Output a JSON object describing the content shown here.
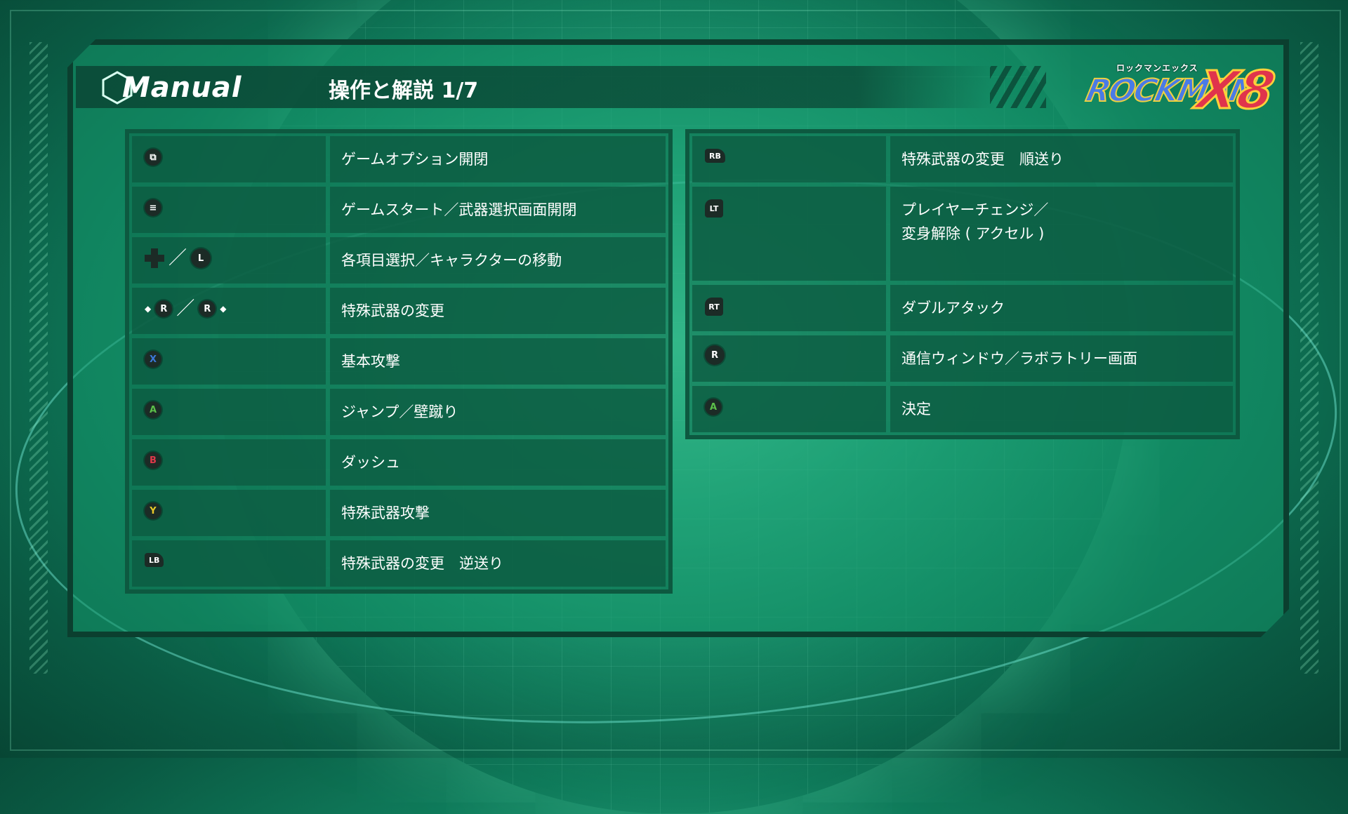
{
  "header": {
    "manual_label": "Manual",
    "page_title": "操作と解説 1/7",
    "game_logo_kana": "ロックマンエックス",
    "game_logo_title": "ROCKMAN",
    "game_logo_number": "X8"
  },
  "left_rows": [
    {
      "icon": "view-button-icon",
      "glyph": "⧉",
      "desc": "ゲームオプション開閉"
    },
    {
      "icon": "menu-button-icon",
      "glyph": "≡",
      "desc": "ゲームスタート／武器選択画面開閉"
    },
    {
      "icon": "dpad-left-stick-icon",
      "glyph": "L",
      "sep": "／",
      "desc": "各項目選択／キャラクターの移動"
    },
    {
      "icon": "right-stick-left-right-icon",
      "glyph_a": "R",
      "glyph_b": "R",
      "sep": "／",
      "desc": "特殊武器の変更"
    },
    {
      "icon": "x-button-icon",
      "glyph": "X",
      "color": "#3c78d8",
      "desc": "基本攻撃"
    },
    {
      "icon": "a-button-icon",
      "glyph": "A",
      "color": "#5cc04a",
      "desc": "ジャンプ／壁蹴り"
    },
    {
      "icon": "b-button-icon",
      "glyph": "B",
      "color": "#e0384a",
      "desc": "ダッシュ"
    },
    {
      "icon": "y-button-icon",
      "glyph": "Y",
      "color": "#e8c82a",
      "desc": "特殊武器攻撃"
    },
    {
      "icon": "lb-button-icon",
      "glyph": "LB",
      "desc": "特殊武器の変更　逆送り"
    }
  ],
  "right_rows": [
    {
      "icon": "rb-button-icon",
      "glyph": "RB",
      "desc": "特殊武器の変更　順送り"
    },
    {
      "icon": "lt-trigger-icon",
      "glyph": "LT",
      "desc": "プレイヤーチェンジ／\n変身解除 ( アクセル )"
    },
    {
      "icon": "rt-trigger-icon",
      "glyph": "RT",
      "desc": "ダブルアタック"
    },
    {
      "icon": "right-stick-press-icon",
      "glyph": "R",
      "desc": "通信ウィンドウ／ラボラトリー画面"
    },
    {
      "icon": "a-button-icon",
      "glyph": "A",
      "color": "#5cc04a",
      "desc": "決定"
    }
  ]
}
